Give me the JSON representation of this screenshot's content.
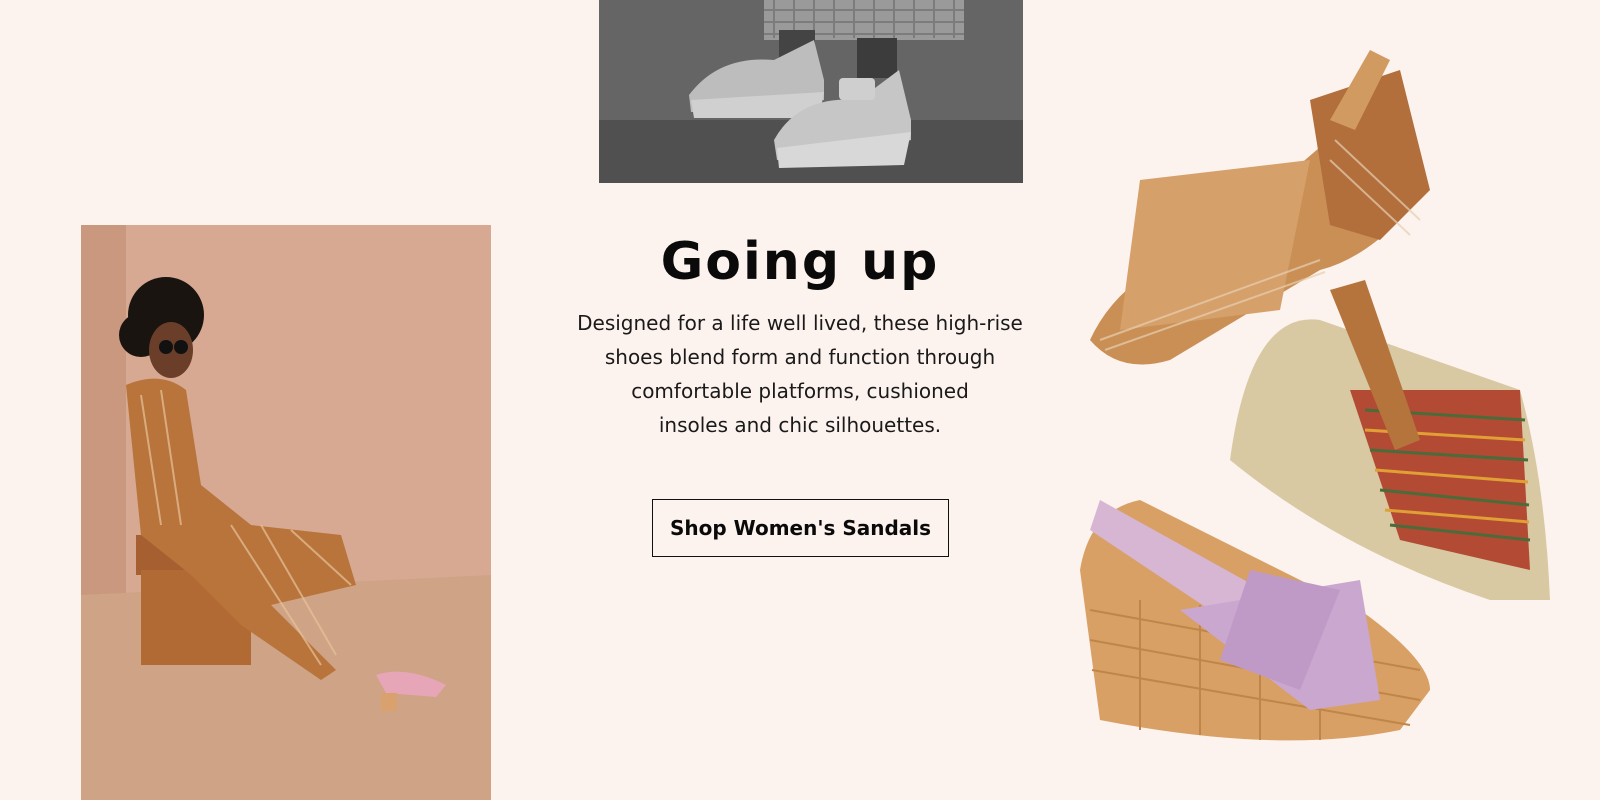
{
  "hero": {
    "title": "Going up",
    "description_lines": [
      "Designed for a life well lived, these high-rise",
      "shoes blend form and function through",
      "comfortable platforms, cushioned",
      "insoles and chic silhouettes."
    ],
    "cta_label": "Shop Women's Sandals"
  },
  "images": {
    "top_photo": "wedge-sandals-grayscale-photo",
    "left_photo": "model-in-striped-jumpsuit-photo",
    "right_products": "sandals-product-shot"
  },
  "colors": {
    "page_background": "#fcf2ee",
    "text": "#0a0a0a",
    "button_border": "#111111"
  }
}
